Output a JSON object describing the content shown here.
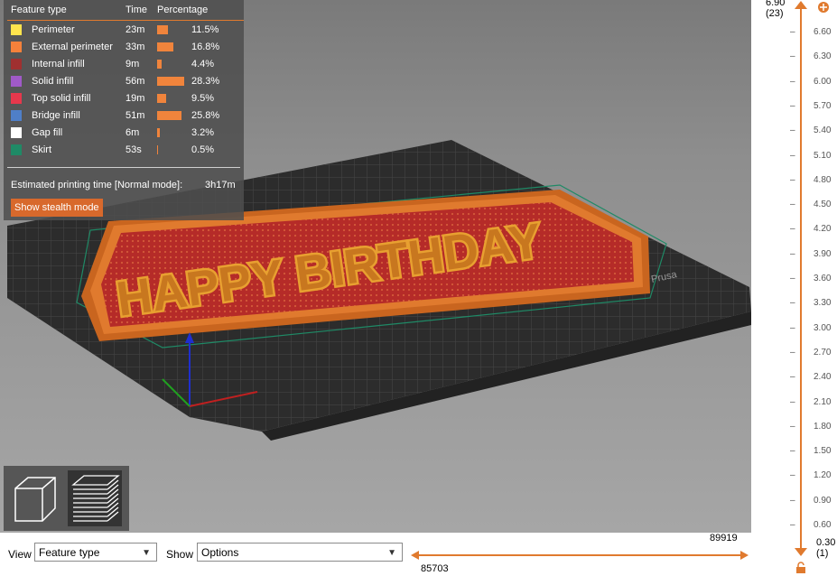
{
  "legend": {
    "headers": {
      "feature": "Feature type",
      "time": "Time",
      "percentage": "Percentage"
    },
    "rows": [
      {
        "name": "Perimeter",
        "time": "23m",
        "percent": "11.5%",
        "fraction": 0.115,
        "color": "#ffe44d"
      },
      {
        "name": "External perimeter",
        "time": "33m",
        "percent": "16.8%",
        "fraction": 0.168,
        "color": "#f5813b"
      },
      {
        "name": "Internal infill",
        "time": "9m",
        "percent": "4.4%",
        "fraction": 0.044,
        "color": "#a03030"
      },
      {
        "name": "Solid infill",
        "time": "56m",
        "percent": "28.3%",
        "fraction": 0.283,
        "color": "#a05ac8"
      },
      {
        "name": "Top solid infill",
        "time": "19m",
        "percent": "9.5%",
        "fraction": 0.095,
        "color": "#e6384c"
      },
      {
        "name": "Bridge infill",
        "time": "51m",
        "percent": "25.8%",
        "fraction": 0.258,
        "color": "#4f7fc8"
      },
      {
        "name": "Gap fill",
        "time": "6m",
        "percent": "3.2%",
        "fraction": 0.032,
        "color": "#ffffff"
      },
      {
        "name": "Skirt",
        "time": "53s",
        "percent": "0.5%",
        "fraction": 0.005,
        "color": "#1f8a66"
      }
    ],
    "estimate_label": "Estimated printing time [Normal mode]:",
    "estimate_value": "3h17m",
    "stealth_button": "Show stealth mode"
  },
  "scene": {
    "text": "HAPPY BIRTHDAY",
    "bed_brand": "Prusa",
    "colors": {
      "plate": "#b52b28",
      "rim": "#e07a2e",
      "bed": "#2f2f2f"
    }
  },
  "toolbar": {
    "view_label": "View",
    "view_value": "Feature type",
    "show_label": "Show",
    "show_value": "Options",
    "h_top_value": "89919",
    "h_bottom_value": "85703"
  },
  "vslider": {
    "top_value": "6.90",
    "top_layer": "(23)",
    "bottom_value": "0.30",
    "bottom_layer": "(1)",
    "ticks": [
      "6.60",
      "6.30",
      "6.00",
      "5.70",
      "5.40",
      "5.10",
      "4.80",
      "4.50",
      "4.20",
      "3.90",
      "3.60",
      "3.30",
      "3.00",
      "2.70",
      "2.40",
      "2.10",
      "1.80",
      "1.50",
      "1.20",
      "0.90",
      "0.60"
    ]
  },
  "accent": "#e07a2e"
}
